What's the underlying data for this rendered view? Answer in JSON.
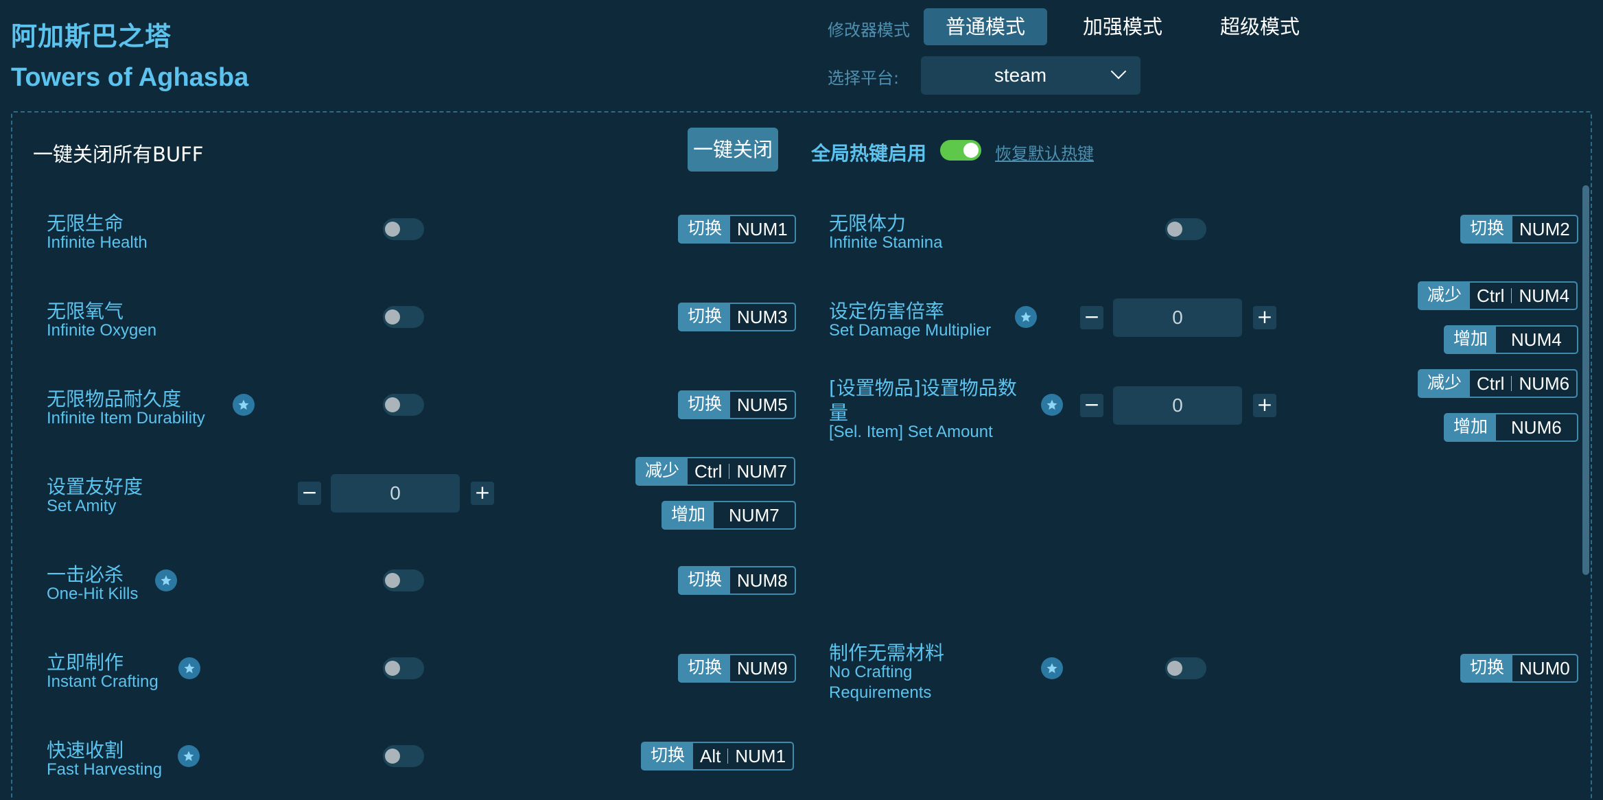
{
  "header": {
    "title_cn": "阿加斯巴之塔",
    "title_en": "Towers of Aghasba",
    "mode_label": "修改器模式",
    "modes": [
      "普通模式",
      "加强模式",
      "超级模式"
    ],
    "active_mode": "普通模式",
    "platform_label": "选择平台:",
    "platform_value": "steam"
  },
  "controls": {
    "close_all_label": "一键关闭所有BUFF",
    "close_all_button": "一键关闭",
    "global_hotkey_label": "全局热键启用",
    "global_hotkey_enabled": true,
    "restore_default": "恢复默认热键"
  },
  "features": {
    "infinite_health": {
      "cn": "无限生命",
      "en": "Infinite Health",
      "action": "切换",
      "key": "NUM1",
      "enabled": false
    },
    "infinite_stamina": {
      "cn": "无限体力",
      "en": "Infinite Stamina",
      "action": "切换",
      "key": "NUM2",
      "enabled": false
    },
    "infinite_oxygen": {
      "cn": "无限氧气",
      "en": "Infinite Oxygen",
      "action": "切换",
      "key": "NUM3",
      "enabled": false
    },
    "damage_multiplier": {
      "cn": "设定伤害倍率",
      "en": "Set Damage Multiplier",
      "value": "0",
      "dec_action": "减少",
      "dec_mod": "Ctrl",
      "dec_key": "NUM4",
      "inc_action": "增加",
      "inc_key": "NUM4"
    },
    "item_durability": {
      "cn": "无限物品耐久度",
      "en": "Infinite Item Durability",
      "action": "切换",
      "key": "NUM5",
      "enabled": false
    },
    "set_amount": {
      "cn_line1": "[设置物品]设置物品数",
      "cn_line2": "量",
      "en": "[Sel. Item] Set Amount",
      "value": "0",
      "dec_action": "减少",
      "dec_mod": "Ctrl",
      "dec_key": "NUM6",
      "inc_action": "增加",
      "inc_key": "NUM6"
    },
    "set_amity": {
      "cn": "设置友好度",
      "en": "Set Amity",
      "value": "0",
      "dec_action": "减少",
      "dec_mod": "Ctrl",
      "dec_key": "NUM7",
      "inc_action": "增加",
      "inc_key": "NUM7"
    },
    "one_hit_kills": {
      "cn": "一击必杀",
      "en": "One-Hit Kills",
      "action": "切换",
      "key": "NUM8",
      "enabled": false
    },
    "instant_crafting": {
      "cn": "立即制作",
      "en": "Instant Crafting",
      "action": "切换",
      "key": "NUM9",
      "enabled": false
    },
    "no_crafting_req": {
      "cn": "制作无需材料",
      "en_line1": "No Crafting",
      "en_line2": "Requirements",
      "action": "切换",
      "key": "NUM0",
      "enabled": false
    },
    "fast_harvesting": {
      "cn": "快速收割",
      "en": "Fast Harvesting",
      "action": "切换",
      "mod": "Alt",
      "key": "NUM1",
      "enabled": false
    }
  },
  "symbols": {
    "minus": "−",
    "plus": "+"
  }
}
